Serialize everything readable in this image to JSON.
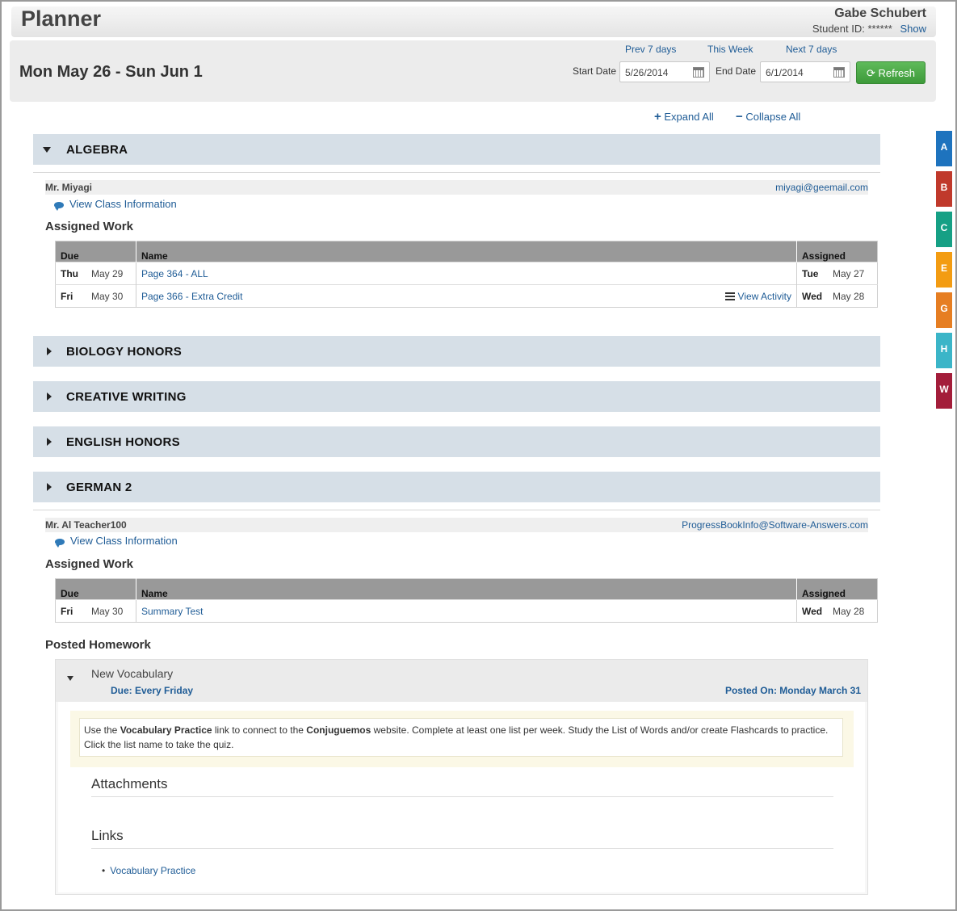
{
  "header": {
    "title": "Planner",
    "student_name": "Gabe Schubert",
    "student_id_label": "Student ID:",
    "student_id_value": "******",
    "show_link": "Show"
  },
  "datebar": {
    "range": "Mon May 26 - Sun Jun 1",
    "prev": "Prev 7 days",
    "this_week": "This Week",
    "next": "Next 7 days",
    "start_label": "Start Date",
    "start_value": "5/26/2014",
    "end_label": "End Date",
    "end_value": "6/1/2014",
    "refresh": "Refresh"
  },
  "controls": {
    "expand_all": "Expand All",
    "collapse_all": "Collapse All"
  },
  "side_tabs": [
    {
      "letter": "A",
      "color": "#1e73be"
    },
    {
      "letter": "B",
      "color": "#c0392b"
    },
    {
      "letter": "C",
      "color": "#16a085"
    },
    {
      "letter": "E",
      "color": "#f39c12"
    },
    {
      "letter": "G",
      "color": "#e67e22"
    },
    {
      "letter": "H",
      "color": "#3bb5c8"
    },
    {
      "letter": "W",
      "color": "#a31d3a"
    }
  ],
  "sections": {
    "algebra": {
      "name": "ALGEBRA",
      "teacher": "Mr. Miyagi",
      "email": "miyagi@geemail.com",
      "view_info": "View Class Information",
      "assigned_title": "Assigned Work",
      "columns": {
        "due": "Due",
        "name": "Name",
        "assigned": "Assigned"
      },
      "rows": [
        {
          "due_day": "Thu",
          "due_date": "May 29",
          "name": "Page 364 - ALL",
          "view": "",
          "as_day": "Tue",
          "as_date": "May 27"
        },
        {
          "due_day": "Fri",
          "due_date": "May 30",
          "name": "Page 366 - Extra Credit",
          "view": "View Activity",
          "as_day": "Wed",
          "as_date": "May 28"
        }
      ]
    },
    "biology": {
      "name": "BIOLOGY HONORS"
    },
    "creative": {
      "name": "CREATIVE WRITING"
    },
    "english": {
      "name": "ENGLISH HONORS"
    },
    "german": {
      "name": "GERMAN 2",
      "teacher": "Mr. Al Teacher100",
      "email": "ProgressBookInfo@Software-Answers.com",
      "view_info": "View Class Information",
      "assigned_title": "Assigned Work",
      "columns": {
        "due": "Due",
        "name": "Name",
        "assigned": "Assigned"
      },
      "rows": [
        {
          "due_day": "Fri",
          "due_date": "May 30",
          "name": "Summary Test",
          "as_day": "Wed",
          "as_date": "May 28"
        }
      ],
      "posted_title": "Posted Homework",
      "homework": {
        "title": "New Vocabulary",
        "due": "Due: Every Friday",
        "posted": "Posted On: Monday March 31",
        "desc_1": "Use the ",
        "desc_b1": "Vocabulary Practice",
        "desc_2": " link to connect to the ",
        "desc_b2": "Conjuguemos",
        "desc_3": " website. Complete at least one list per week. Study the List of Words and/or create Flashcards to practice. Click the list name to take the quiz.",
        "attachments": "Attachments",
        "links": "Links",
        "link_item": "Vocabulary Practice"
      }
    }
  }
}
